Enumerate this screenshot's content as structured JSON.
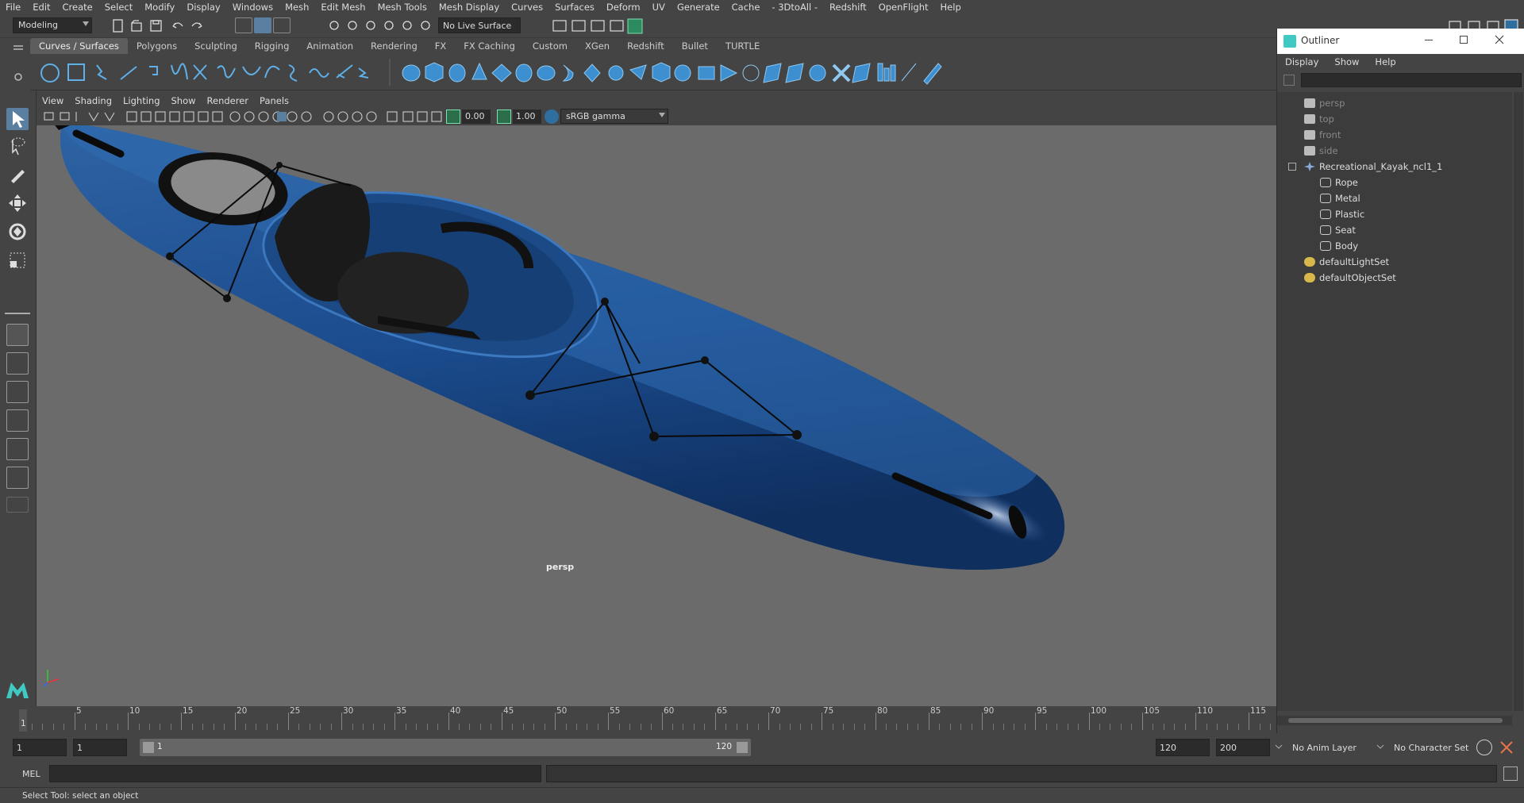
{
  "menubar": {
    "items": [
      "File",
      "Edit",
      "Create",
      "Select",
      "Modify",
      "Display",
      "Windows",
      "Mesh",
      "Edit Mesh",
      "Mesh Tools",
      "Mesh Display",
      "Curves",
      "Surfaces",
      "Deform",
      "UV",
      "Generate",
      "Cache",
      "- 3DtoAll -",
      "Redshift",
      "OpenFlight",
      "Help"
    ]
  },
  "status_line": {
    "workspace_value": "Modeling",
    "live_surface": "No Live Surface"
  },
  "shelf": {
    "tabs": [
      "Curves / Surfaces",
      "Polygons",
      "Sculpting",
      "Rigging",
      "Animation",
      "Rendering",
      "FX",
      "FX Caching",
      "Custom",
      "XGen",
      "Redshift",
      "Bullet",
      "TURTLE"
    ],
    "active_tab": "Curves / Surfaces"
  },
  "panel": {
    "menu": [
      "View",
      "Shading",
      "Lighting",
      "Show",
      "Renderer",
      "Panels"
    ],
    "exposure_value": "0.00",
    "gamma_value": "1.00",
    "color_space": "sRGB gamma",
    "camera_label": "persp"
  },
  "outliner": {
    "title": "Outliner",
    "menu": [
      "Display",
      "Show",
      "Help"
    ],
    "items": [
      {
        "label": "persp",
        "type": "camera",
        "indent": 0,
        "dim": true
      },
      {
        "label": "top",
        "type": "camera",
        "indent": 0,
        "dim": true
      },
      {
        "label": "front",
        "type": "camera",
        "indent": 0,
        "dim": true
      },
      {
        "label": "side",
        "type": "camera",
        "indent": 0,
        "dim": true
      },
      {
        "label": "Recreational_Kayak_ncl1_1",
        "type": "group",
        "indent": 0,
        "dim": false
      },
      {
        "label": "Rope",
        "type": "mesh",
        "indent": 1,
        "dim": false
      },
      {
        "label": "Metal",
        "type": "mesh",
        "indent": 1,
        "dim": false
      },
      {
        "label": "Plastic",
        "type": "mesh",
        "indent": 1,
        "dim": false
      },
      {
        "label": "Seat",
        "type": "mesh",
        "indent": 1,
        "dim": false
      },
      {
        "label": "Body",
        "type": "mesh",
        "indent": 1,
        "dim": false
      },
      {
        "label": "defaultLightSet",
        "type": "set",
        "indent": 0,
        "dim": false
      },
      {
        "label": "defaultObjectSet",
        "type": "set",
        "indent": 0,
        "dim": false
      }
    ]
  },
  "timeline": {
    "ticks": [
      "5",
      "10",
      "15",
      "20",
      "25",
      "30",
      "35",
      "40",
      "45",
      "50",
      "55",
      "60",
      "65",
      "70",
      "75",
      "80",
      "85",
      "90",
      "95",
      "100",
      "105",
      "110",
      "115"
    ],
    "current_frame": "1"
  },
  "range": {
    "start_field": "1",
    "playback_start": "1",
    "slider_start": "1",
    "slider_end": "120",
    "playback_end": "120",
    "end_field": "200",
    "anim_layer": "No Anim Layer",
    "character_set": "No Character Set"
  },
  "command": {
    "language": "MEL"
  },
  "help_line": "Select Tool: select an object"
}
